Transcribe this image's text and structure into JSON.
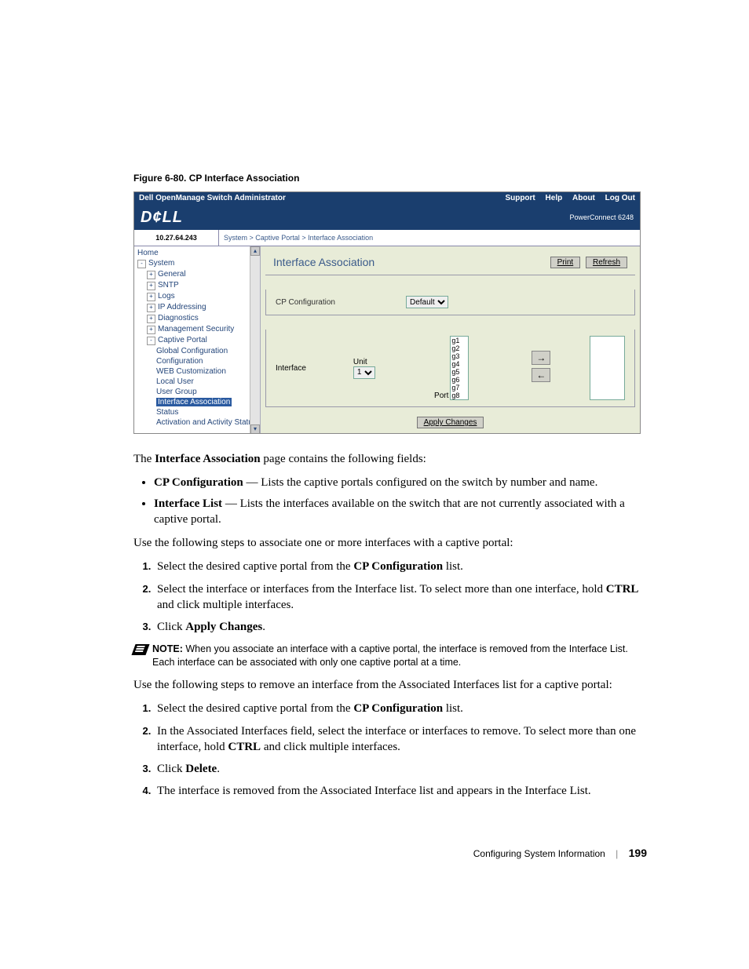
{
  "figure_caption": "Figure 6-80.    CP Interface Association",
  "shot": {
    "title_left": "Dell OpenManage Switch Administrator",
    "title_links": [
      "Support",
      "Help",
      "About",
      "Log Out"
    ],
    "logo": "D¢LL",
    "model": "PowerConnect 6248",
    "ip": "10.27.64.243",
    "crumb": [
      "System",
      "Captive Portal",
      "Interface Association"
    ],
    "nav": [
      {
        "lvl": 0,
        "pm": "",
        "label": "Home"
      },
      {
        "lvl": 0,
        "pm": "-",
        "label": "System"
      },
      {
        "lvl": 1,
        "pm": "+",
        "label": "General"
      },
      {
        "lvl": 1,
        "pm": "+",
        "label": "SNTP"
      },
      {
        "lvl": 1,
        "pm": "+",
        "label": "Logs"
      },
      {
        "lvl": 1,
        "pm": "+",
        "label": "IP Addressing"
      },
      {
        "lvl": 1,
        "pm": "+",
        "label": "Diagnostics"
      },
      {
        "lvl": 1,
        "pm": "+",
        "label": "Management Security"
      },
      {
        "lvl": 1,
        "pm": "-",
        "label": "Captive Portal"
      },
      {
        "lvl": 2,
        "pm": "",
        "label": "Global Configuration"
      },
      {
        "lvl": 2,
        "pm": "",
        "label": "Configuration"
      },
      {
        "lvl": 2,
        "pm": "",
        "label": "WEB Customization"
      },
      {
        "lvl": 2,
        "pm": "",
        "label": "Local User"
      },
      {
        "lvl": 2,
        "pm": "",
        "label": "User Group"
      },
      {
        "lvl": 2,
        "pm": "",
        "label": "Interface Association",
        "sel": true
      },
      {
        "lvl": 2,
        "pm": "",
        "label": "Status"
      },
      {
        "lvl": 2,
        "pm": "",
        "label": "Activation and Activity Status"
      }
    ],
    "panel_title": "Interface Association",
    "print": "Print",
    "refresh": "Refresh",
    "cp_conf_label": "CP Configuration",
    "cp_conf_value": "Default",
    "iface_label": "Interface",
    "unit_label": "Unit",
    "unit_value": "1",
    "port_label": "Port",
    "ports": [
      "g1",
      "g2",
      "g3",
      "g4",
      "g5",
      "g6",
      "g7",
      "g8"
    ],
    "apply": "Apply Changes"
  },
  "prose": {
    "intro": "The Interface Association page contains the following fields:",
    "bullets": [
      {
        "term": "CP Configuration",
        "desc": " — Lists the captive portals configured on the switch by number and name."
      },
      {
        "term": "Interface List",
        "desc": " — Lists the interfaces available on the switch that are not currently associated with a captive portal."
      }
    ],
    "assoc_lead": "Use the following steps to associate one or more interfaces with a captive portal:",
    "assoc_steps": [
      "Select the desired captive portal from the <b>CP Configuration</b> list.",
      "Select the interface or interfaces from the Interface list. To select more than one interface, hold <b>CTRL</b> and click multiple interfaces.",
      "Click <b>Apply Changes</b>."
    ],
    "note_label": "NOTE:",
    "note_text": " When you associate an interface with a captive portal, the interface is removed from the Interface List. Each interface can be associated with only one captive portal at a time.",
    "remove_lead": "Use the following steps to remove an interface from the Associated Interfaces list for a captive portal:",
    "remove_steps": [
      "Select the desired captive portal from the <b>CP Configuration</b> list.",
      "In the Associated Interfaces field, select the interface or interfaces to remove. To select more than one interface, hold <b>CTRL</b> and click multiple interfaces.",
      "Click <b>Delete</b>.",
      "The interface is removed from the Associated Interface list and appears in the Interface List."
    ]
  },
  "footer": {
    "section": "Configuring System Information",
    "page": "199"
  }
}
